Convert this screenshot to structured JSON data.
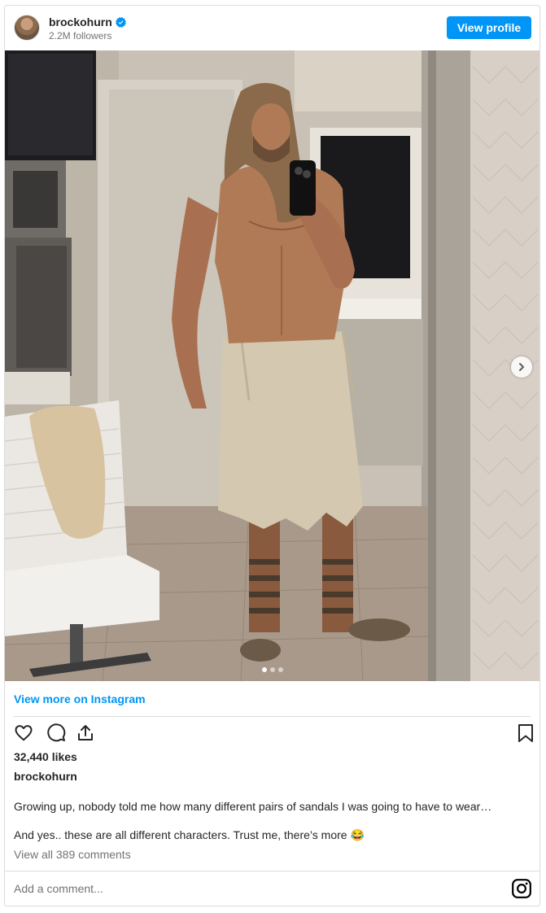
{
  "header": {
    "username": "brockohurn",
    "followers": "2.2M followers",
    "view_profile_label": "View profile"
  },
  "media": {
    "slide_count": 3,
    "active_slide": 1
  },
  "links": {
    "view_more": "View more on Instagram"
  },
  "post": {
    "likes": "32,440 likes",
    "author": "brockohurn",
    "caption_line1": "Growing up, nobody told me how many different pairs of sandals I was going to have to wear…",
    "caption_line2": "And yes.. these are all different characters. Trust me, there’s more 😂",
    "view_comments": "View all 389 comments"
  },
  "comment_box": {
    "placeholder": "Add a comment..."
  },
  "icons": {
    "like": "heart-icon",
    "comment": "comment-icon",
    "share": "share-icon",
    "save": "bookmark-icon",
    "brand": "instagram-icon",
    "verified": "verified-badge-icon",
    "next": "chevron-right-icon"
  },
  "colors": {
    "accent": "#0095f6",
    "text": "#262626",
    "muted": "#737373",
    "border": "#dbdbdb"
  }
}
